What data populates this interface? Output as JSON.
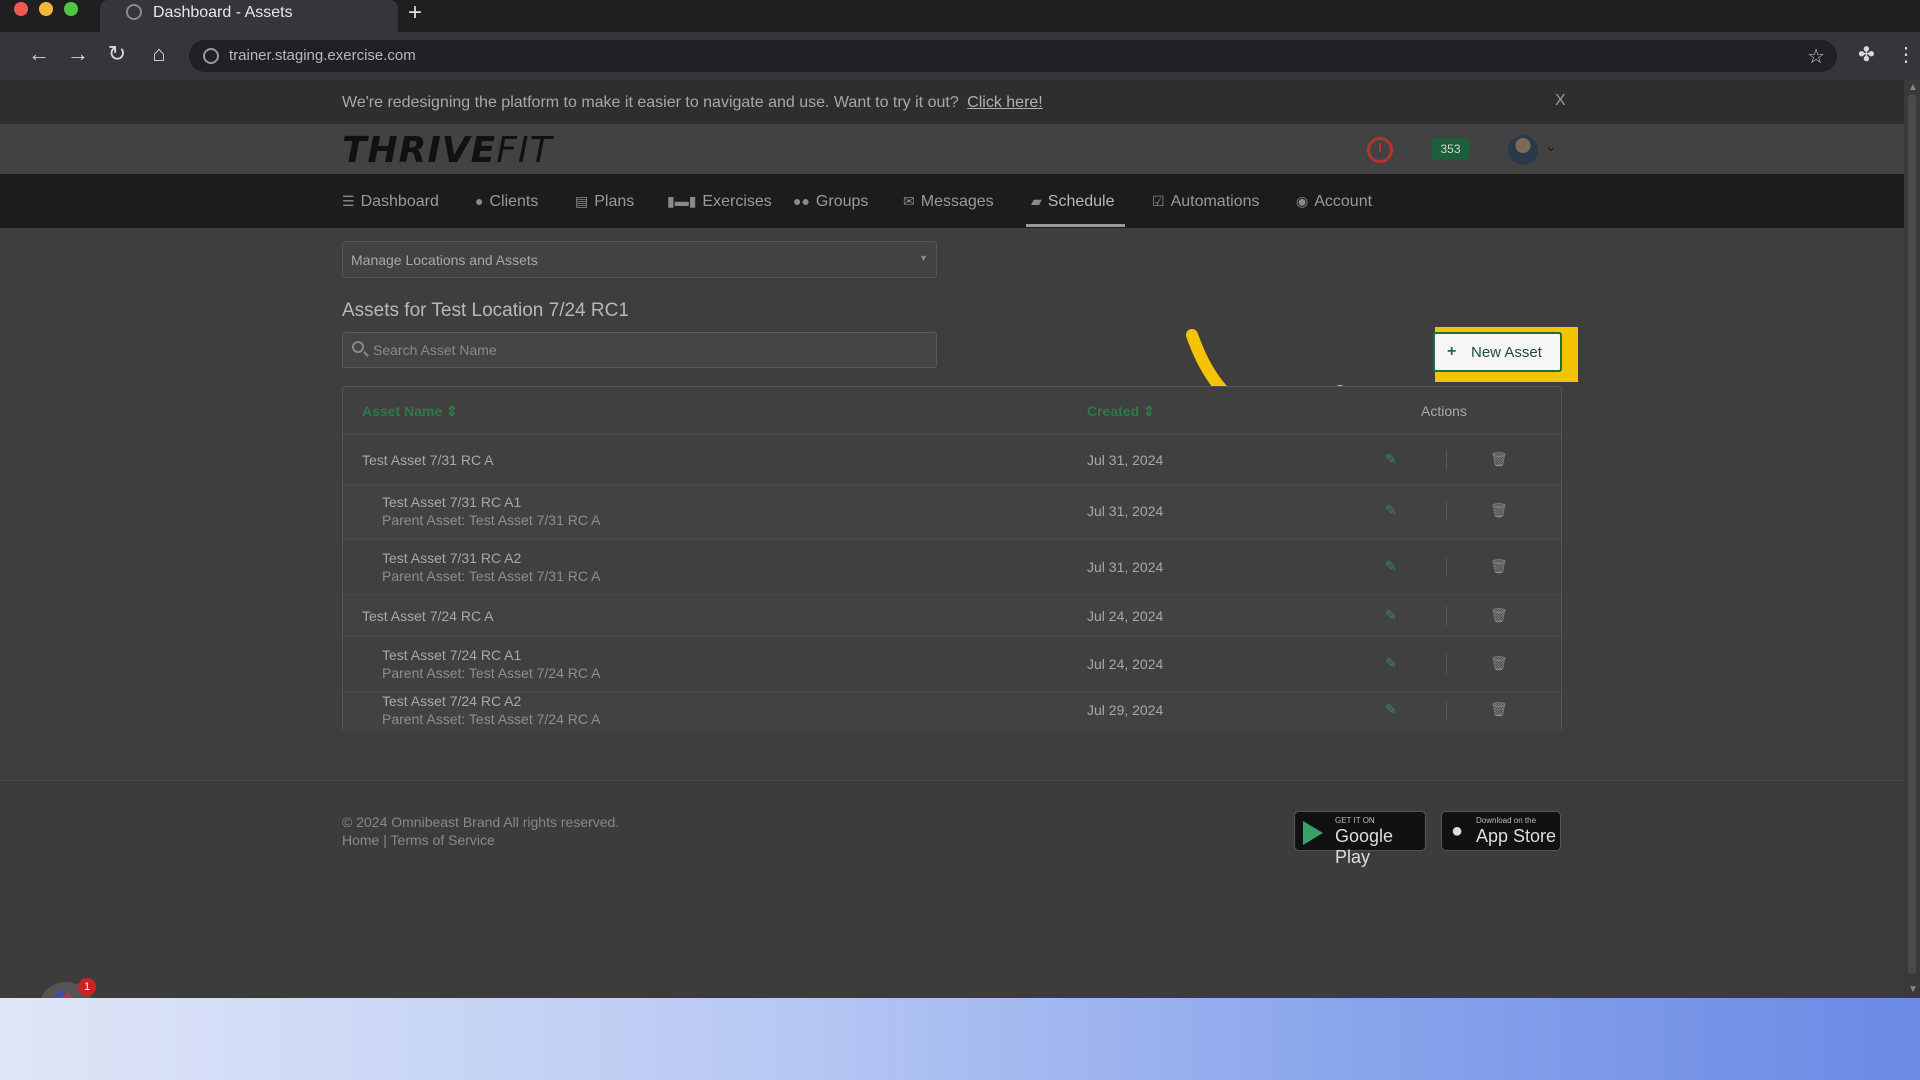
{
  "browser": {
    "tab_title": "Dashboard - Assets",
    "new_tab": "+",
    "url": "trainer.staging.exercise.com"
  },
  "banner": {
    "message": "We're redesigning the platform to make it easier to navigate and use. Want to try it out?",
    "link": "Click here!",
    "close": "X"
  },
  "header": {
    "logo_bold": "THRIVE",
    "logo_light": "FIT",
    "badge_count": "353"
  },
  "nav": {
    "items": [
      {
        "label": "Dashboard",
        "icon": "list-icon"
      },
      {
        "label": "Clients",
        "icon": "user-icon"
      },
      {
        "label": "Plans",
        "icon": "clipboard-icon"
      },
      {
        "label": "Exercises",
        "icon": "dumbbell-icon"
      },
      {
        "label": "Groups",
        "icon": "users-icon"
      },
      {
        "label": "Messages",
        "icon": "envelope-icon"
      },
      {
        "label": "Schedule",
        "icon": "book-icon"
      },
      {
        "label": "Automations",
        "icon": "check-square-icon"
      },
      {
        "label": "Account",
        "icon": "user-circle-icon"
      }
    ],
    "active": "Schedule"
  },
  "manage_select": {
    "value": "Manage Locations and Assets"
  },
  "assets": {
    "title": "Assets for Test Location 7/24 RC1",
    "search_placeholder": "Search Asset Name",
    "new_button": "New Asset",
    "columns": {
      "name": "Asset Name",
      "created": "Created",
      "actions": "Actions"
    },
    "rows": [
      {
        "name": "Test Asset 7/31 RC A",
        "parent": "",
        "created": "Jul 31, 2024"
      },
      {
        "name": "Test Asset 7/31 RC A1",
        "parent": "Parent Asset: Test Asset 7/31 RC A",
        "created": "Jul 31, 2024"
      },
      {
        "name": "Test Asset 7/31 RC A2",
        "parent": "Parent Asset: Test Asset 7/31 RC A",
        "created": "Jul 31, 2024"
      },
      {
        "name": "Test Asset 7/24 RC A",
        "parent": "",
        "created": "Jul 24, 2024"
      },
      {
        "name": "Test Asset 7/24 RC A1",
        "parent": "Parent Asset: Test Asset 7/24 RC A",
        "created": "Jul 24, 2024"
      },
      {
        "name": "Test Asset 7/24 RC A2",
        "parent": "Parent Asset: Test Asset 7/24 RC A",
        "created": "Jul 29, 2024"
      }
    ]
  },
  "footer": {
    "copyright": "© 2024 Omnibeast Brand All rights reserved.",
    "home": "Home",
    "divider": "|",
    "terms": "Terms of Service",
    "google_small": "GET IT ON",
    "google_big": "Google Play",
    "apple_small": "Download on the",
    "apple_big": "App Store"
  },
  "widget": {
    "notification_count": "1"
  },
  "colors": {
    "accent_green": "#1e6e3e",
    "highlight_yellow": "#f5c400"
  }
}
